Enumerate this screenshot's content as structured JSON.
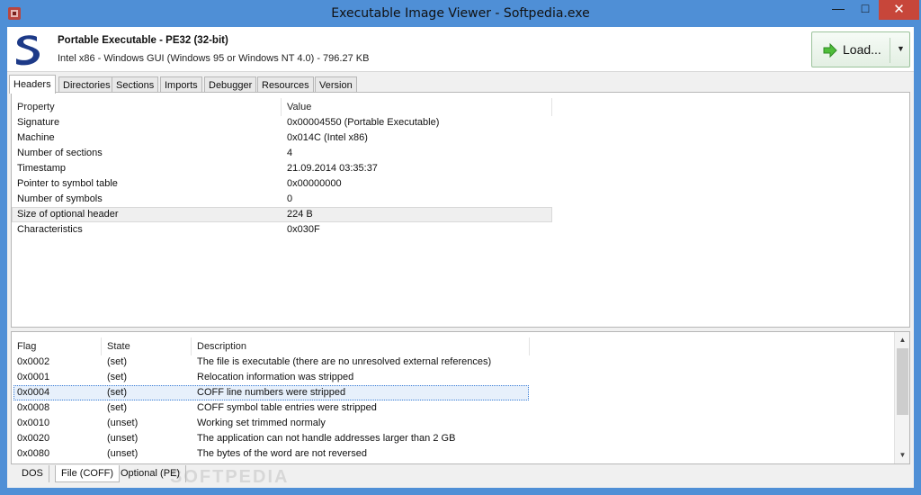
{
  "window": {
    "title": "Executable Image Viewer - Softpedia.exe"
  },
  "header": {
    "pe_title": "Portable Executable - PE32 (32-bit)",
    "pe_subtitle": "Intel x86 - Windows GUI (Windows 95 or Windows NT 4.0) - 796.27 KB",
    "load_label": "Load...",
    "accent_color": "#4f8fd6"
  },
  "tabs": [
    "Headers",
    "Directories",
    "Sections",
    "Imports",
    "Debugger",
    "Resources",
    "Version"
  ],
  "active_tab": "Headers",
  "headers_table": {
    "columns": [
      "Property",
      "Value"
    ],
    "rows": [
      [
        "Signature",
        "0x00004550 (Portable Executable)"
      ],
      [
        "Machine",
        "0x014C (Intel x86)"
      ],
      [
        "Number of sections",
        "4"
      ],
      [
        "Timestamp",
        "21.09.2014 03:35:37"
      ],
      [
        "Pointer to symbol table",
        "0x00000000"
      ],
      [
        "Number of symbols",
        "0"
      ],
      [
        "Size of optional header",
        "224 B"
      ],
      [
        "Characteristics",
        "0x030F"
      ]
    ],
    "highlighted_row": 4
  },
  "flags_table": {
    "columns": [
      "Flag",
      "State",
      "Description"
    ],
    "rows": [
      [
        "0x0002",
        "(set)",
        "The file is executable (there are no unresolved external references)"
      ],
      [
        "0x0001",
        "(set)",
        "Relocation information was stripped"
      ],
      [
        "0x0004",
        "(set)",
        "COFF line numbers were stripped"
      ],
      [
        "0x0008",
        "(set)",
        "COFF symbol table entries were stripped"
      ],
      [
        "0x0010",
        "(unset)",
        "Working set trimmed normaly"
      ],
      [
        "0x0020",
        "(unset)",
        "The application can not handle addresses larger than 2 GB"
      ],
      [
        "0x0080",
        "(unset)",
        "The bytes of the word are not reversed"
      ]
    ],
    "selected_row": 2
  },
  "bottom_tabs": [
    "DOS",
    "File (COFF)",
    "Optional (PE)"
  ],
  "active_bottom_tab": "File (COFF)",
  "watermark": "SOFTPEDIA"
}
